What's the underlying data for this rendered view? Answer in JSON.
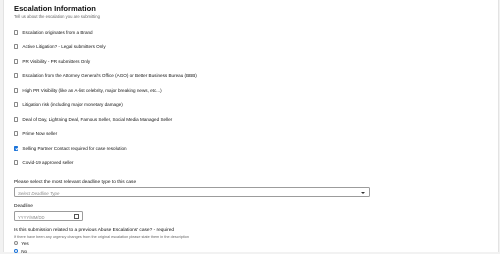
{
  "section": {
    "title": "Escalation Information",
    "subtitle": "Tell us about the escalation you are submitting"
  },
  "checkboxes": [
    {
      "label": "Escalation originates from a Brand",
      "checked": false
    },
    {
      "label": "Active Litigation? - Legal submitters Only",
      "checked": false
    },
    {
      "label": "PR Visibility - PR submitters Only",
      "checked": false
    },
    {
      "label": "Escalation from the Attorney General's Office (AGO) or Better Business Bureau (BBB)",
      "checked": false
    },
    {
      "label": "High PR Visibility (like an A-list celebrity, major breaking news, etc...)",
      "checked": false
    },
    {
      "label": "Litigation risk (including major monetary damage)",
      "checked": false
    },
    {
      "label": "Deal of Day, Lightning Deal, Famous Seller, Social Media Managed Seller",
      "checked": false
    },
    {
      "label": "Prime Now seller",
      "checked": false
    },
    {
      "label": "Selling Partner Contact required for case resolution",
      "checked": true
    },
    {
      "label": "Covid-19 approved seller",
      "checked": false
    }
  ],
  "deadline_type": {
    "label": "Please select the most relevant deadline type to this case",
    "placeholder": "Select Deadline Type"
  },
  "deadline": {
    "label": "Deadline",
    "placeholder": "YYYY/MM/DD"
  },
  "abuse_question": {
    "label": "Is this submission related to a previous Abuse Escalations' case? - required",
    "hint": "If there have been any urgency changes from the original escalation please state them in the description",
    "options": [
      {
        "label": "Yes",
        "selected": false
      },
      {
        "label": "No",
        "selected": true
      }
    ]
  }
}
